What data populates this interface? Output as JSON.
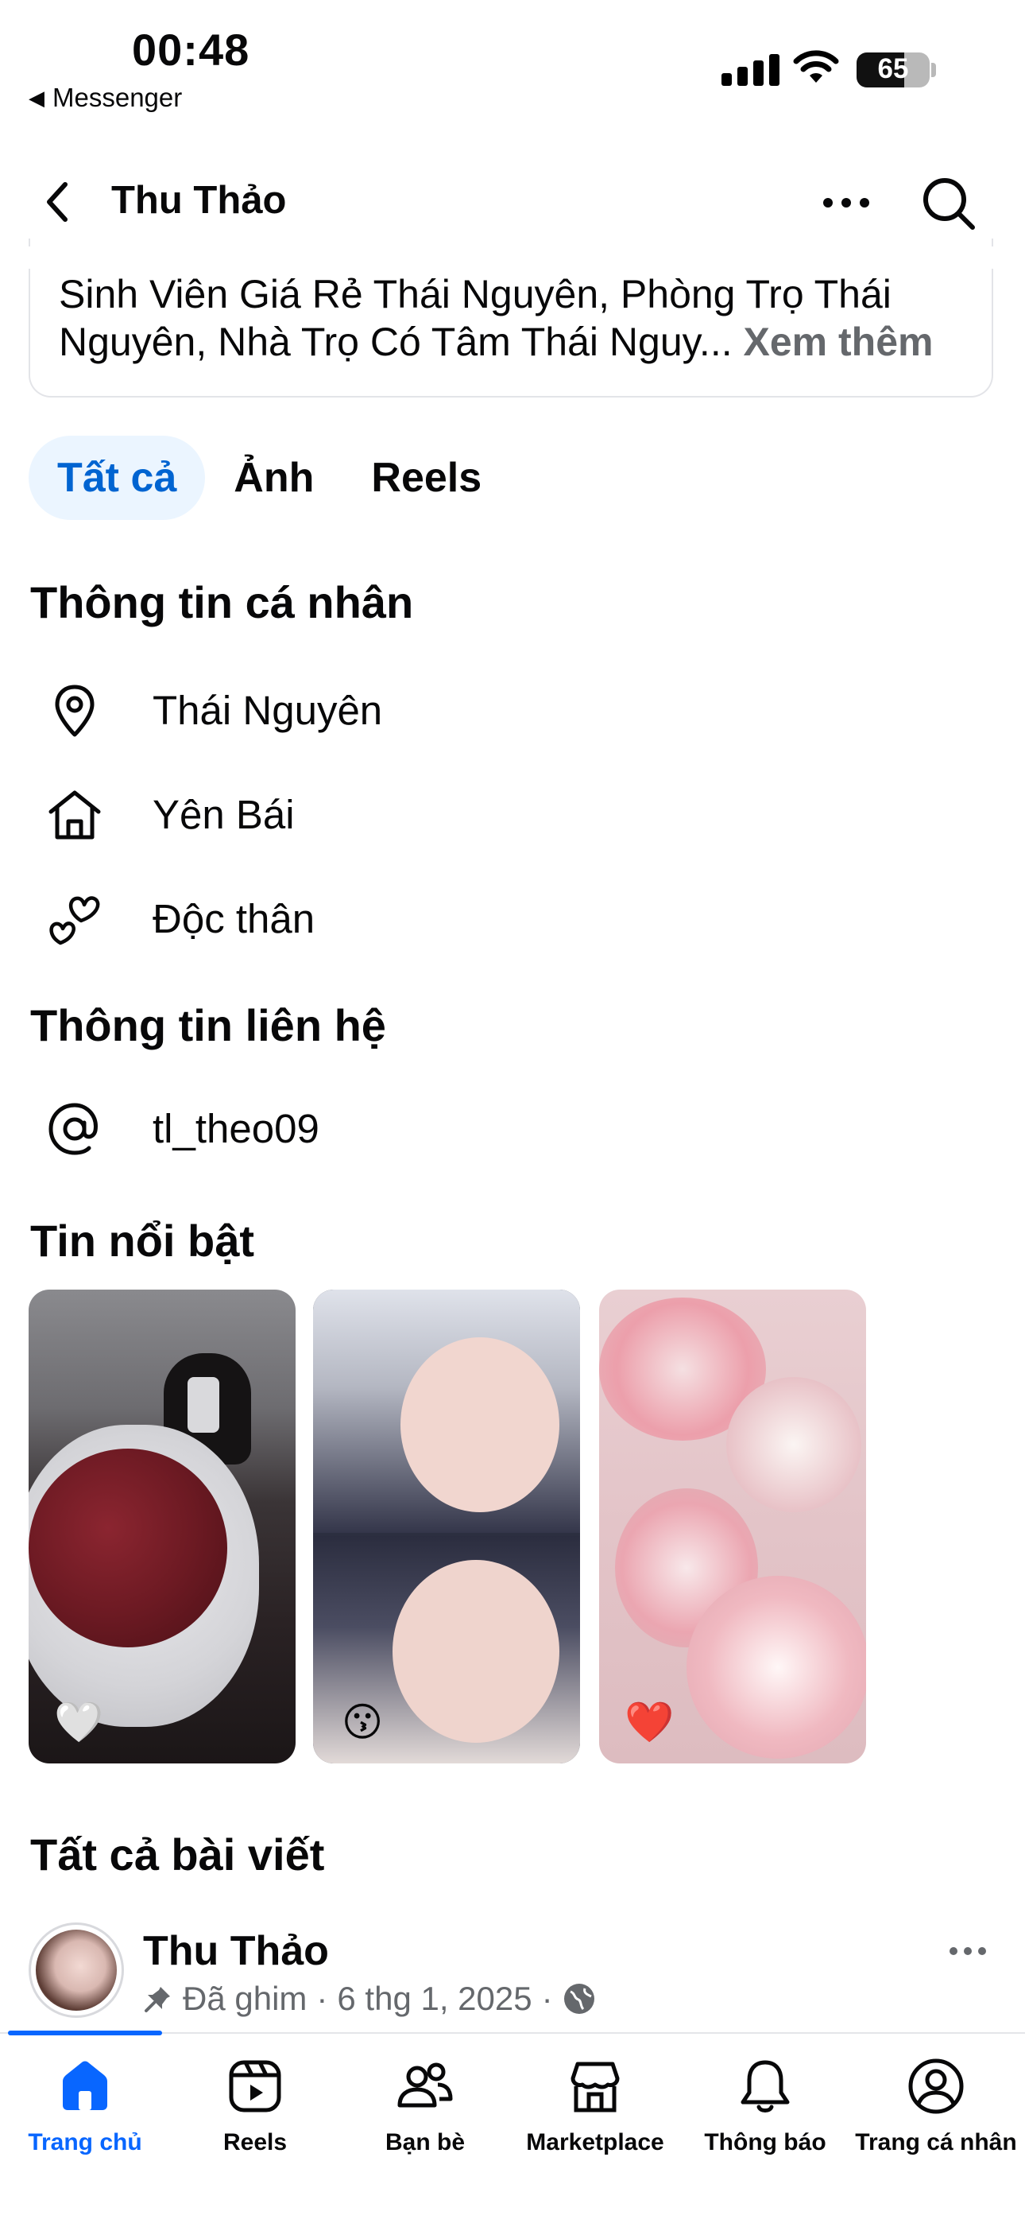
{
  "status_bar": {
    "time": "00:48",
    "back_app": "Messenger",
    "battery": "65",
    "battery_level_percent": 65
  },
  "header": {
    "title": "Thu Thảo"
  },
  "bio": {
    "clipped_line": "Sinh Viên Giá Rẻ Thái Nguyên, Phòng Trọ Thái",
    "line1": "Sinh Viên Giá Rẻ Thái Nguyên, Phòng Trọ Thái",
    "line2": "Nguyên, Nhà Trọ Có Tâm Thái Nguy...",
    "see_more": "Xem thêm"
  },
  "tabs": [
    {
      "label": "Tất cả",
      "active": true
    },
    {
      "label": "Ảnh",
      "active": false
    },
    {
      "label": "Reels",
      "active": false
    }
  ],
  "personal_info": {
    "title": "Thông tin cá nhân",
    "items": [
      {
        "icon": "location-pin-icon",
        "text": "Thái Nguyên"
      },
      {
        "icon": "home-icon",
        "text": "Yên Bái"
      },
      {
        "icon": "relationship-hearts-icon",
        "text": "Độc thân"
      }
    ]
  },
  "contact_info": {
    "title": "Thông tin liên hệ",
    "items": [
      {
        "icon": "at-sign-icon",
        "text": "tl_theo09"
      }
    ]
  },
  "highlights": {
    "title": "Tin nổi bật",
    "items": [
      {
        "emoji": "🤍",
        "label": "white-heart"
      },
      {
        "emoji": "😗",
        "label": "kissing-face"
      },
      {
        "emoji": "❤️",
        "label": "red-heart"
      }
    ]
  },
  "posts": {
    "title": "Tất cả bài viết",
    "first_post": {
      "author": "Thu Thảo",
      "pinned": "Đã ghim",
      "separator": "·",
      "date": "6 thg 1, 2025"
    }
  },
  "bottom_nav": [
    {
      "label": "Trang chủ",
      "icon": "home-filled-icon",
      "active": true
    },
    {
      "label": "Reels",
      "icon": "reels-icon",
      "active": false
    },
    {
      "label": "Bạn bè",
      "icon": "friends-icon",
      "active": false
    },
    {
      "label": "Marketplace",
      "icon": "marketplace-icon",
      "active": false
    },
    {
      "label": "Thông báo",
      "icon": "bell-icon",
      "active": false
    },
    {
      "label": "Trang cá nhân",
      "icon": "profile-icon",
      "active": false
    }
  ],
  "colors": {
    "accent": "#0866ff",
    "tab_active_bg": "#ebf5ff",
    "muted_text": "#65686c"
  }
}
